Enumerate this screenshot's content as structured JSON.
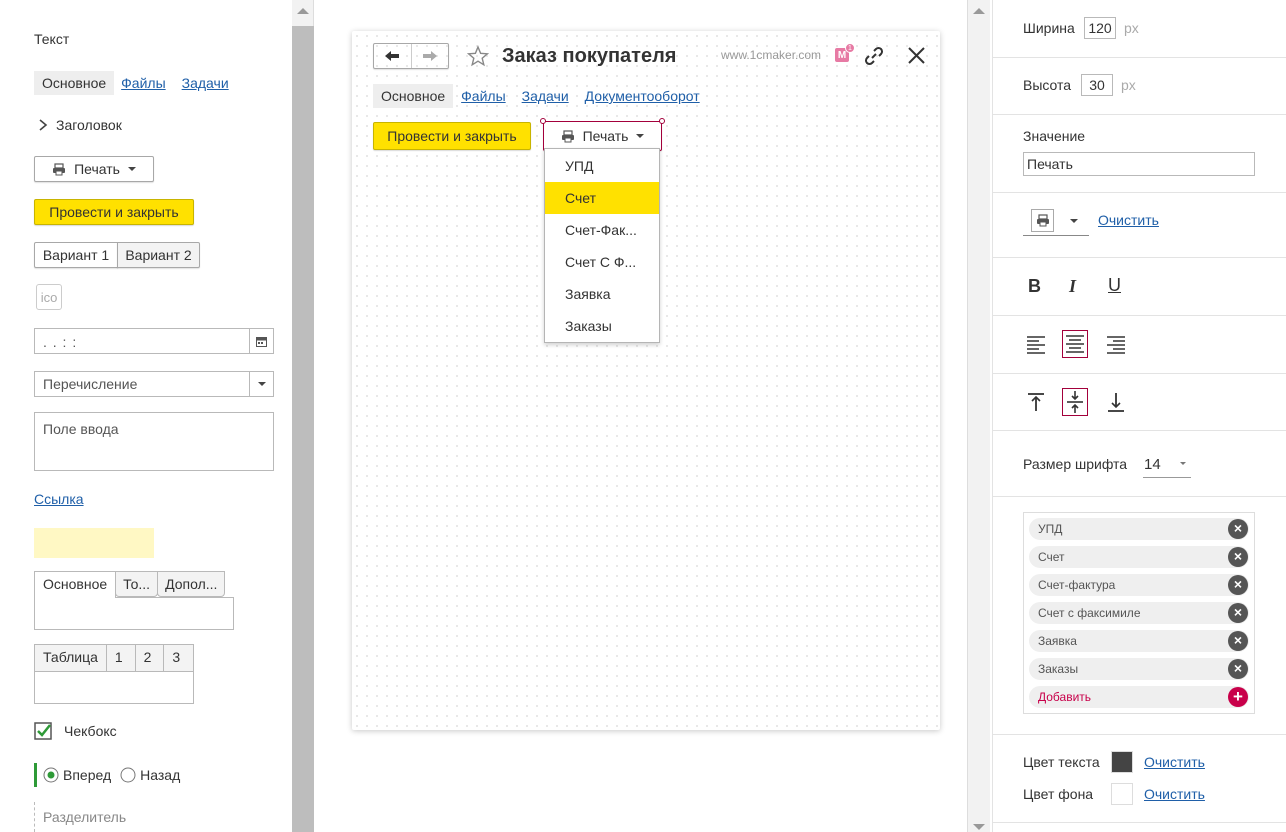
{
  "palette": {
    "label_text": "Текст",
    "tabs": [
      "Основное",
      "Файлы",
      "Задачи"
    ],
    "group_label": "Заголовок",
    "print_label": "Печать",
    "post_close_label": "Провести и закрыть",
    "variant1": "Вариант 1",
    "variant2": "Вариант 2",
    "ico_label": "ico",
    "date_placeholder": ". . : :",
    "enum_placeholder": "Перечисление",
    "textarea_placeholder": "Поле ввода",
    "link_label": "Ссылка",
    "page_tabs": [
      "Основное",
      "То...",
      "Допол..."
    ],
    "table_headers": [
      "Таблица",
      "1",
      "2",
      "3"
    ],
    "checkbox_label": "Чекбокс",
    "radio_options": [
      "Вперед",
      "Назад"
    ],
    "separator_label": "Разделитель"
  },
  "form": {
    "title": "Заказ покупателя",
    "site": "www.1cmaker.com",
    "badge_letter": "M",
    "badge_count": "1",
    "tabs": [
      "Основное",
      "Файлы",
      "Задачи",
      "Документооборот"
    ],
    "post_close_label": "Провести и закрыть",
    "print_label": "Печать",
    "menu_items": [
      "УПД",
      "Счет",
      "Счет-Фак...",
      "Счет С Ф...",
      "Заявка",
      "Заказы"
    ],
    "menu_selected_index": 1
  },
  "props": {
    "width_label": "Ширина",
    "width_value": "120",
    "height_label": "Высота",
    "height_value": "30",
    "unit": "px",
    "value_label": "Значение",
    "value_text": "Печать",
    "clear_label": "Очистить",
    "bold": "B",
    "italic": "I",
    "underline": "U",
    "font_size_label": "Размер шрифта",
    "font_size_value": "14",
    "list_items": [
      "УПД",
      "Счет",
      "Счет-фактура",
      "Счет с факсимиле",
      "Заявка",
      "Заказы"
    ],
    "add_label": "Добавить",
    "text_color_label": "Цвет текста",
    "bg_color_label": "Цвет фона"
  },
  "colors": {
    "accent_yellow": "#ffe100",
    "menu_border": "#a3003b",
    "add_red": "#c8004a",
    "checkbox_green": "#2e9a37",
    "text_color_swatch": "#444444"
  }
}
